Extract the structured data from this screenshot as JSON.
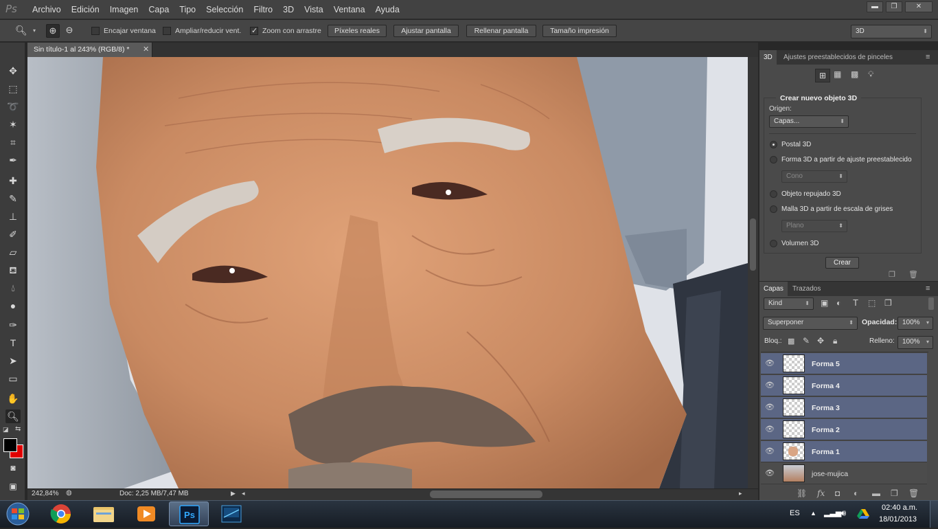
{
  "app": {
    "logo": "Ps"
  },
  "menu": [
    "Archivo",
    "Edición",
    "Imagen",
    "Capa",
    "Tipo",
    "Selección",
    "Filtro",
    "3D",
    "Vista",
    "Ventana",
    "Ayuda"
  ],
  "options": {
    "encajar": "Encajar ventana",
    "ampliar": "Ampliar/reducir vent.",
    "zoom_arrastre": "Zoom con arrastre",
    "btn_pixeles": "Píxeles reales",
    "btn_ajustar": "Ajustar pantalla",
    "btn_rellenar": "Rellenar pantalla",
    "btn_tamano": "Tamaño impresión",
    "workspace": "3D"
  },
  "document": {
    "tab_label": "Sin título-1 al 243% (RGB/8) *",
    "zoom": "242,84%",
    "doc_info": "Doc: 2,25 MB/7,47 MB"
  },
  "panel3d": {
    "tab_3d": "3D",
    "tab_presets": "Ajustes preestablecidos de pinceles",
    "header": "Crear nuevo objeto 3D",
    "origin_label": "Origen:",
    "origin_value": "Capas...",
    "opt_postal": "Postal 3D",
    "opt_forma": "Forma 3D a partir de ajuste preestablecido",
    "forma_value": "Cono",
    "opt_repujado": "Objeto repujado 3D",
    "opt_malla": "Malla 3D a partir de escala de grises",
    "malla_value": "Plano",
    "opt_volumen": "Volumen 3D",
    "btn_crear": "Crear"
  },
  "layers": {
    "tab_capas": "Capas",
    "tab_trazados": "Trazados",
    "kind": "Kind",
    "blend": "Superponer",
    "opacity_label": "Opacidad:",
    "opacity_value": "100%",
    "lock_label": "Bloq.:",
    "fill_label": "Relleno:",
    "fill_value": "100%",
    "items": [
      {
        "name": "Forma 5"
      },
      {
        "name": "Forma 4"
      },
      {
        "name": "Forma 3"
      },
      {
        "name": "Forma 2"
      },
      {
        "name": "Forma 1"
      },
      {
        "name": "jose-mujica"
      }
    ]
  },
  "taskbar": {
    "lang": "ES",
    "time": "02:40 a.m.",
    "date": "18/01/2013"
  }
}
